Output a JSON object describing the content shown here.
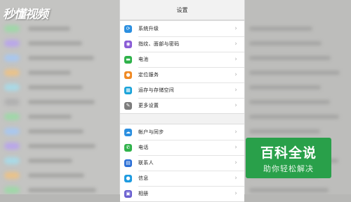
{
  "watermark": {
    "text": "秒懂视频"
  },
  "settings": {
    "title": "设置",
    "group1": [
      {
        "label": "系统升级",
        "icon": "system-update-icon",
        "color": "#2b8fe0",
        "glyph": "⟳"
      },
      {
        "label": "指纹、面部与密码",
        "icon": "fingerprint-icon",
        "color": "#8a5cd6",
        "glyph": "◉"
      },
      {
        "label": "电池",
        "icon": "battery-icon",
        "color": "#2fb24a",
        "glyph": "▬"
      },
      {
        "label": "定位服务",
        "icon": "location-icon",
        "color": "#f08a24",
        "glyph": "●"
      },
      {
        "label": "运存与存储空间",
        "icon": "storage-icon",
        "color": "#1aa3d9",
        "glyph": "▦"
      },
      {
        "label": "更多设置",
        "icon": "wrench-icon",
        "color": "#7d7d7d",
        "glyph": "✎"
      }
    ],
    "group2": [
      {
        "label": "帐户与同步",
        "icon": "cloud-icon",
        "color": "#2b8fe0",
        "glyph": "☁"
      },
      {
        "label": "电话",
        "icon": "phone-icon",
        "color": "#2fb24a",
        "glyph": "✆"
      },
      {
        "label": "联系人",
        "icon": "contacts-icon",
        "color": "#2b6fd6",
        "glyph": "▤"
      },
      {
        "label": "信息",
        "icon": "message-icon",
        "color": "#1e9be0",
        "glyph": "●"
      },
      {
        "label": "相册",
        "icon": "album-icon",
        "color": "#6a5fd0",
        "glyph": "▣"
      }
    ]
  },
  "badge": {
    "title": "百科全说",
    "subtitle": "助你轻松解决",
    "color": "#29a04a"
  }
}
